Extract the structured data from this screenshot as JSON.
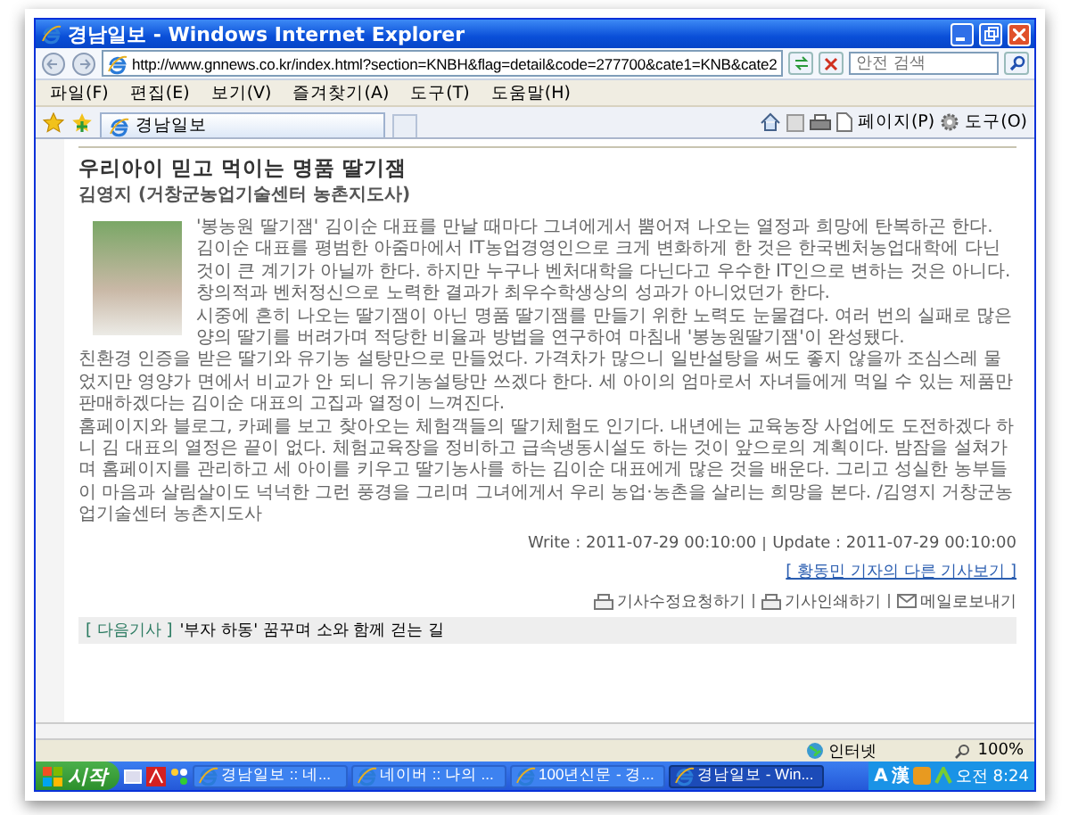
{
  "window": {
    "title": "경남일보 - Windows Internet Explorer"
  },
  "address_bar": {
    "url": "http://www.gnnews.co.kr/index.html?section=KNBH&flag=detail&code=277700&cate1=KNB&cate2",
    "search_placeholder": "안전 검색"
  },
  "menu": {
    "items": [
      "파일(F)",
      "편집(E)",
      "보기(V)",
      "즐겨찾기(A)",
      "도구(T)",
      "도움말(H)"
    ]
  },
  "tab_bar": {
    "tab": "경남일보",
    "page_menu": "페이지(P)",
    "tools_menu": "도구(O)"
  },
  "article": {
    "title": "우리아이 믿고 먹이는 명품 딸기잼",
    "byline": "김영지 (거창군농업기술센터 농촌지도사)",
    "paragraphs": [
      "'봉농원 딸기잼' 김이순 대표를 만날 때마다 그녀에게서 뿜어져 나오는 열정과 희망에 탄복하곤 한다.",
      "김이순 대표를 평범한 아줌마에서 IT농업경영인으로 크게 변화하게 한 것은 한국벤처농업대학에 다닌 것이 큰 계기가 아닐까 한다. 하지만 누구나 벤처대학을 다닌다고 우수한 IT인으로 변하는 것은 아니다. 창의적과 벤처정신으로 노력한 결과가 최우수학생상의 성과가 아니었던가 한다.",
      "시중에 흔히 나오는 딸기잼이 아닌 명품 딸기잼를 만들기 위한 노력도 눈물겹다. 여러 번의 실패로 많은 양의 딸기를 버려가며 적당한 비율과 방법을 연구하여 마침내 '봉농원딸기잼'이 완성됐다.",
      "친환경 인증을 받은 딸기와 유기농 설탕만으로 만들었다. 가격차가 많으니 일반설탕을 써도 좋지 않을까 조심스레 물었지만 영양가 면에서 비교가 안 되니 유기농설탕만 쓰겠다 한다. 세 아이의 엄마로서 자녀들에게 먹일 수 있는 제품만 판매하겠다는 김이순 대표의 고집과 열정이 느껴진다.",
      "홈페이지와 블로그, 카페를 보고 찾아오는 체험객들의 딸기체험도 인기다. 내년에는 교육농장 사업에도 도전하겠다 하니 김 대표의 열정은 끝이 없다. 체험교육장을 정비하고 급속냉동시설도 하는 것이 앞으로의 계획이다. 밤잠을 설쳐가며 홈페이지를 관리하고 세 아이를 키우고 딸기농사를 하는 김이순 대표에게 많은 것을 배운다. 그리고 성실한 농부들이 마음과 살림살이도 넉넉한 그런 풍경을 그리며 그녀에게서 우리 농업·농촌을 살리는 희망을 본다. /김영지 거창군농업기술센터 농촌지도사"
    ],
    "write": "Write : 2011-07-29 00:10:00",
    "update": "Update : 2011-07-29 00:10:00",
    "other_articles_link": "[ 황동민 기자의 다른 기사보기 ]",
    "actions": [
      {
        "kind": "print",
        "label": "기사수정요청하기"
      },
      {
        "kind": "print",
        "label": "기사인쇄하기"
      },
      {
        "kind": "mail",
        "label": "메일로보내기"
      }
    ],
    "next_label": "[ 다음기사 ]",
    "next_title": "'부자 하동' 꿈꾸며 소와 함께 걷는 길"
  },
  "status_bar": {
    "zone": "인터넷",
    "zoom": "100%"
  },
  "taskbar": {
    "start": "시작",
    "tasks": [
      {
        "label": "경남일보 :: 네...",
        "selected": false
      },
      {
        "label": "네이버 :: 나의 ...",
        "selected": false
      },
      {
        "label": "100년신문 - 경...",
        "selected": false
      },
      {
        "label": "경남일보 - Win...",
        "selected": true
      }
    ],
    "tray_text": [
      "A",
      "漢"
    ],
    "clock": "오전 8:24"
  }
}
